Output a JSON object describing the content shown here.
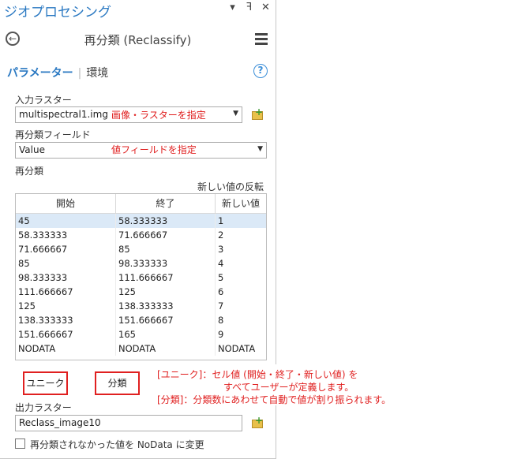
{
  "app": {
    "title": "ジオプロセシング",
    "controls": {
      "menu": "▾",
      "pin": "ꟻ",
      "close": "✕"
    }
  },
  "tool": {
    "title": "再分類 (Reclassify)"
  },
  "tabs": {
    "parameters": "パラメーター",
    "separator": "|",
    "environments": "環境"
  },
  "input_raster": {
    "label": "入力ラスター",
    "value": "multispectral1.img",
    "annotation": "画像・ラスターを指定"
  },
  "reclass_field": {
    "label": "再分類フィールド",
    "value": "Value",
    "annotation": "値フィールドを指定"
  },
  "reclassification": {
    "label": "再分類",
    "reverse_link": "新しい値の反転",
    "columns": [
      "開始",
      "終了",
      "新しい値"
    ],
    "rows": [
      [
        "45",
        "58.333333",
        "1"
      ],
      [
        "58.333333",
        "71.666667",
        "2"
      ],
      [
        "71.666667",
        "85",
        "3"
      ],
      [
        "85",
        "98.333333",
        "4"
      ],
      [
        "98.333333",
        "111.666667",
        "5"
      ],
      [
        "111.666667",
        "125",
        "6"
      ],
      [
        "125",
        "138.333333",
        "7"
      ],
      [
        "138.333333",
        "151.666667",
        "8"
      ],
      [
        "151.666667",
        "165",
        "9"
      ],
      [
        "NODATA",
        "NODATA",
        "NODATA"
      ]
    ]
  },
  "buttons": {
    "unique": "ユニーク",
    "classify": "分類"
  },
  "callout": {
    "line1": "[ユニーク]：セル値 (開始・終了・新しい値) を",
    "line2": "すべてユーザーが定義します。",
    "line3": "[分類]：分類数にあわせて自動で値が割り振られます。"
  },
  "output_raster": {
    "label": "出力ラスター",
    "value": "Reclass_image10"
  },
  "nodata_option": {
    "label": "再分類されなかった値を NoData に変更",
    "checked": false
  },
  "colors": {
    "accent": "#2b79c2",
    "annotation": "#e02020",
    "selected_row": "#dbe9f7"
  }
}
